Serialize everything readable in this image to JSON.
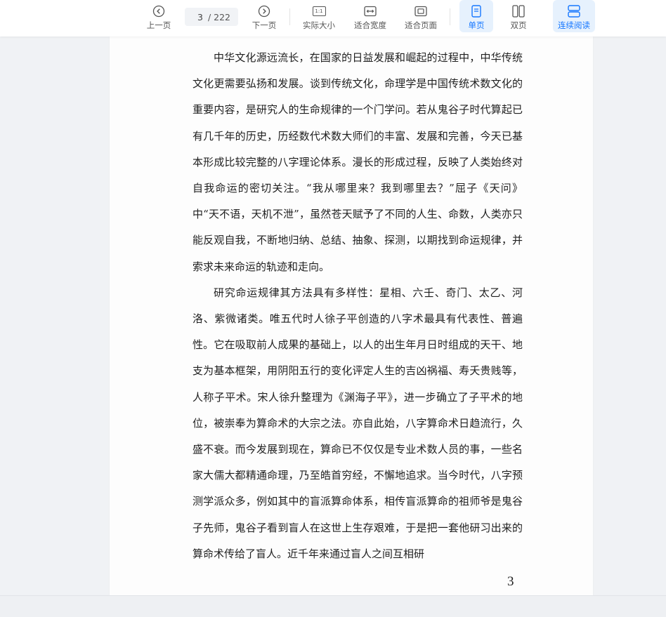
{
  "toolbar": {
    "prev": "上一页",
    "next": "下一页",
    "current_page": "3",
    "total_pages": "/ 222",
    "actual_size": "实际大小",
    "fit_width": "适合宽度",
    "fit_page": "适合页面",
    "single": "单页",
    "double": "双页",
    "continuous": "连续阅读",
    "actual_size_glyph": "1:1",
    "accent_color": "#1677ff"
  },
  "document": {
    "paragraphs": [
      "中华文化源远流长，在国家的日益发展和崛起的过程中，中华传统文化更需要弘扬和发展。谈到传统文化，命理学是中国传统术数文化的重要内容，是研究人的生命规律的一个门学问。若从鬼谷子时代算起已有几千年的历史，历经数代术数大师们的丰富、发展和完善，今天已基本形成比较完整的八字理论体系。漫长的形成过程，反映了人类始终对自我命运的密切关注。“我从哪里来？我到哪里去？”屈子《天问》中“天不语，天机不泄”，虽然苍天赋予了不同的人生、命数，人类亦只能反观自我，不断地归纳、总结、抽象、探测，以期找到命运规律，并索求未来命运的轨迹和走向。",
      "研究命运规律其方法具有多样性：星相、六壬、奇门、太乙、河洛、紫微诸类。唯五代时人徐子平创造的八字术最具有代表性、普遍性。它在吸取前人成果的基础上，以人的出生年月日时组成的天干、地支为基本框架，用阴阳五行的变化评定人生的吉凶祸福、寿夭贵贱等，人称子平术。宋人徐升整理为《渊海子平》，进一步确立了子平术的地位，被崇奉为算命术的大宗之法。亦自此始，八字算命术日趋流行，久盛不衰。而今发展到现在，算命已不仅仅是专业术数人员的事，一些名家大儒大都精通命理，乃至皓首穷经，不懈地追求。当今时代，八字预测学派众多，例如其中的盲派算命体系，相传盲派算命的祖师爷是鬼谷子先师，鬼谷子看到盲人在这世上生存艰难，于是把一套他研习出来的算命术传给了盲人。近千年来通过盲人之间互相研"
    ],
    "page_number": "3"
  }
}
